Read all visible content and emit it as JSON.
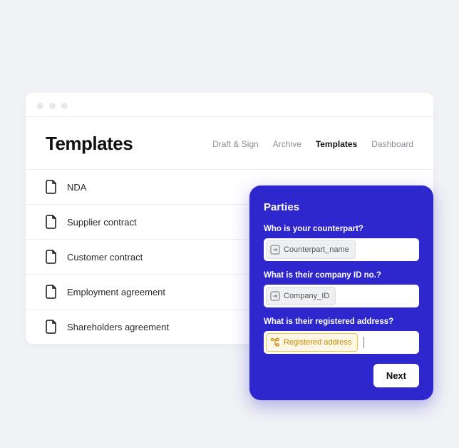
{
  "header": {
    "title": "Templates",
    "tabs": [
      {
        "label": "Draft & Sign",
        "active": false
      },
      {
        "label": "Archive",
        "active": false
      },
      {
        "label": "Templates",
        "active": true
      },
      {
        "label": "Dashboard",
        "active": false
      }
    ]
  },
  "templates": [
    {
      "label": "NDA"
    },
    {
      "label": "Supplier contract"
    },
    {
      "label": "Customer contract"
    },
    {
      "label": "Employment agreement"
    },
    {
      "label": "Shareholders agreement"
    }
  ],
  "panel": {
    "title": "Parties",
    "fields": {
      "counterpart": {
        "label": "Who is your counterpart?",
        "chip": "Counterpart_name"
      },
      "company_id": {
        "label": "What is their company ID no.?",
        "chip": "Company_ID"
      },
      "address": {
        "label": "What is their registered address?",
        "chip": "Registered address"
      }
    },
    "next_label": "Next"
  }
}
